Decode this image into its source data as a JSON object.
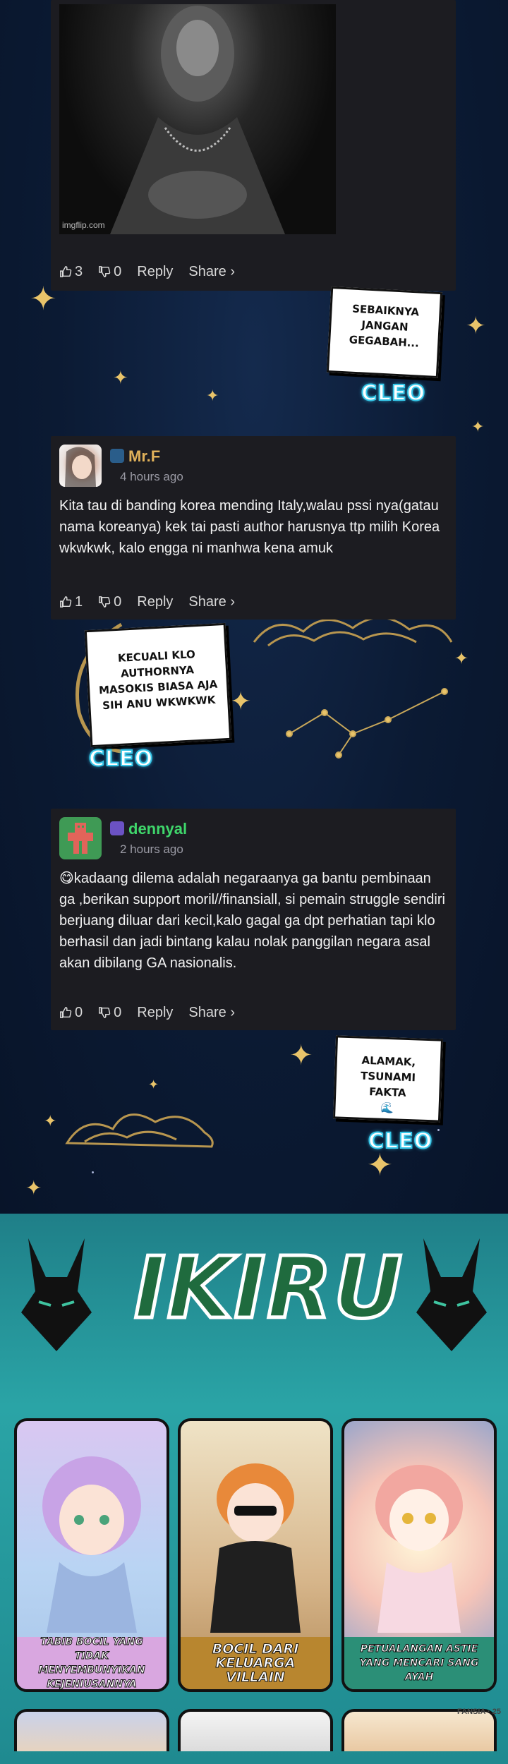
{
  "comments": [
    {
      "image_watermark": "imgflip.com",
      "likes": "3",
      "dislikes": "0",
      "reply_label": "Reply",
      "share_label": "Share ›"
    },
    {
      "username": "Mr.F",
      "time": "4 hours ago",
      "text": "Kita tau di banding korea mending Italy,walau pssi nya(gatau nama koreanya) kek tai pasti author harusnya ttp milih Korea wkwkwk, kalo engga ni manhwa kena amuk",
      "likes": "1",
      "dislikes": "0",
      "reply_label": "Reply",
      "share_label": "Share ›",
      "name_color": "#e0b15a"
    },
    {
      "username": "dennyal",
      "time": "2 hours ago",
      "text": "😋kadaang dilema adalah negaraanya ga bantu pembinaan ga ,berikan support moril//finansiall, si pemain struggle sendiri berjuang diluar dari kecil,kalo gagal ga dpt perhatian tapi klo berhasil dan jadi bintang kalau nolak panggilan negara asal akan dibilang GA nasionalis.",
      "likes": "0",
      "dislikes": "0",
      "reply_label": "Reply",
      "share_label": "Share ›",
      "name_color": "#3fd66b"
    }
  ],
  "bubbles": [
    {
      "text": "SEBAIKNYA\nJANGAN\nGEGABAH...",
      "speaker": "CLEO"
    },
    {
      "text": "KECUALI KLO\nAUTHORNYA\nMASOKIS BIASA AJA\nSIH ANU WKWKWK",
      "speaker": "CLEO"
    },
    {
      "text": "ALAMAK,\nTSUNAMI FAKTA\n🌊",
      "speaker": "CLEO"
    }
  ],
  "promo": {
    "logo": "IKIRU",
    "titles": [
      "TABIB BOCIL YANG TIDAK MENYEMBUNYIKAN KEJENIUSANNYA",
      "BOCIL DARI KELUARGA VILLAIN",
      "PETUALANGAN ASTIE YANG MENCARI SANG AYAH"
    ],
    "watermark": "FANSIA · 25"
  },
  "colors": {
    "card_bg": "#1c1c21",
    "cleo_glow": "#36c6e8",
    "star_gold": "#e9c46a",
    "teal": "#2aa4a6",
    "logo_green": "#1f6b3e"
  }
}
